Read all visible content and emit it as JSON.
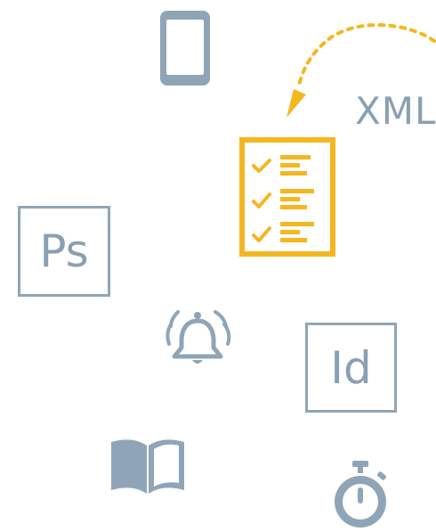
{
  "labels": {
    "xml": "XML",
    "photoshop": "Ps",
    "indesign": "Id"
  },
  "icons": [
    "smartphone-icon",
    "dashed-arrow-icon",
    "checklist-document-icon",
    "photoshop-icon",
    "ringing-bell-icon",
    "indesign-icon",
    "open-book-icon",
    "stopwatch-icon"
  ],
  "colors": {
    "icon_gray": "#8fa5b7",
    "accent_yellow": "#f4b720",
    "background": "#ffffff"
  }
}
